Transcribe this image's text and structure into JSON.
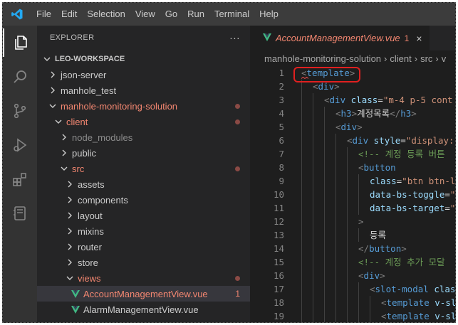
{
  "menu": [
    "File",
    "Edit",
    "Selection",
    "View",
    "Go",
    "Run",
    "Terminal",
    "Help"
  ],
  "icons": {
    "logo": "vscode-logo-icon",
    "explorer": "files-icon",
    "search": "search-icon",
    "scm": "source-control-icon",
    "debug": "run-debug-icon",
    "extensions": "extensions-icon",
    "notebook": "remote-explorer-icon"
  },
  "sidebar": {
    "title": "EXPLORER",
    "more": "···",
    "workspace": "LEO-WORKSPACE",
    "tree": [
      {
        "label": "json-server",
        "depth": 0,
        "open": false,
        "color": "normal"
      },
      {
        "label": "manhole_test",
        "depth": 0,
        "open": false,
        "color": "normal"
      },
      {
        "label": "manhole-monitoring-solution",
        "depth": 0,
        "open": true,
        "color": "red",
        "dot": true
      },
      {
        "label": "client",
        "depth": 1,
        "open": true,
        "color": "red",
        "dot": true
      },
      {
        "label": "node_modules",
        "depth": 2,
        "open": false,
        "color": "dim"
      },
      {
        "label": "public",
        "depth": 2,
        "open": false,
        "color": "normal"
      },
      {
        "label": "src",
        "depth": 2,
        "open": true,
        "color": "red",
        "dot": true
      },
      {
        "label": "assets",
        "depth": 3,
        "open": false,
        "color": "normal"
      },
      {
        "label": "components",
        "depth": 3,
        "open": false,
        "color": "normal"
      },
      {
        "label": "layout",
        "depth": 3,
        "open": false,
        "color": "normal"
      },
      {
        "label": "mixins",
        "depth": 3,
        "open": false,
        "color": "normal"
      },
      {
        "label": "router",
        "depth": 3,
        "open": false,
        "color": "normal"
      },
      {
        "label": "store",
        "depth": 3,
        "open": false,
        "color": "normal"
      },
      {
        "label": "views",
        "depth": 3,
        "open": true,
        "color": "red",
        "dot": true
      },
      {
        "label": "AccountManagementView.vue",
        "depth": 4,
        "file": true,
        "color": "red",
        "selected": true,
        "badge": "1"
      },
      {
        "label": "AlarmManagementView.vue",
        "depth": 4,
        "file": true,
        "color": "normal"
      }
    ]
  },
  "editor": {
    "tab": {
      "label": "AccountManagementView.vue",
      "errors": "1",
      "close": "×"
    },
    "breadcrumb": [
      "manhole-monitoring-solution",
      "client",
      "src",
      "v"
    ],
    "lines": [
      {
        "n": "1",
        "indent": 0,
        "parts": [
          [
            "br",
            "<"
          ],
          [
            "tag",
            "template"
          ],
          [
            "br",
            ">"
          ]
        ]
      },
      {
        "n": "2",
        "indent": 1,
        "parts": [
          [
            "br",
            "<"
          ],
          [
            "tag",
            "div"
          ],
          [
            "br",
            ">"
          ]
        ]
      },
      {
        "n": "3",
        "indent": 2,
        "parts": [
          [
            "br",
            "<"
          ],
          [
            "tag",
            "div"
          ],
          [
            "txt",
            " "
          ],
          [
            "attr",
            "class"
          ],
          [
            "txt",
            "="
          ],
          [
            "str",
            "\"m-4 p-5 cont"
          ]
        ]
      },
      {
        "n": "4",
        "indent": 3,
        "parts": [
          [
            "br",
            "<"
          ],
          [
            "tag",
            "h3"
          ],
          [
            "br",
            ">"
          ],
          [
            "txt",
            "계정목록"
          ],
          [
            "br",
            "</"
          ],
          [
            "tag",
            "h3"
          ],
          [
            "br",
            ">"
          ]
        ]
      },
      {
        "n": "5",
        "indent": 3,
        "parts": [
          [
            "br",
            "<"
          ],
          [
            "tag",
            "div"
          ],
          [
            "br",
            ">"
          ]
        ]
      },
      {
        "n": "6",
        "indent": 4,
        "parts": [
          [
            "br",
            "<"
          ],
          [
            "tag",
            "div"
          ],
          [
            "txt",
            " "
          ],
          [
            "attr",
            "style"
          ],
          [
            "txt",
            "="
          ],
          [
            "str",
            "\"display:"
          ]
        ]
      },
      {
        "n": "7",
        "indent": 5,
        "parts": [
          [
            "com",
            "<!-- 계정 등록 버튼"
          ]
        ]
      },
      {
        "n": "8",
        "indent": 5,
        "parts": [
          [
            "br",
            "<"
          ],
          [
            "tag",
            "button"
          ]
        ]
      },
      {
        "n": "9",
        "indent": 6,
        "parts": [
          [
            "attr",
            "class"
          ],
          [
            "txt",
            "="
          ],
          [
            "str",
            "\"btn btn-l"
          ]
        ]
      },
      {
        "n": "10",
        "indent": 6,
        "parts": [
          [
            "attr",
            "data-bs-toggle"
          ],
          [
            "txt",
            "="
          ],
          [
            "str",
            "\""
          ]
        ]
      },
      {
        "n": "11",
        "indent": 6,
        "parts": [
          [
            "attr",
            "data-bs-target"
          ],
          [
            "txt",
            "="
          ],
          [
            "str",
            "\""
          ]
        ]
      },
      {
        "n": "12",
        "indent": 5,
        "parts": [
          [
            "br",
            ">"
          ]
        ]
      },
      {
        "n": "13",
        "indent": 6,
        "parts": [
          [
            "txt",
            "등록"
          ]
        ]
      },
      {
        "n": "14",
        "indent": 5,
        "parts": [
          [
            "br",
            "</"
          ],
          [
            "tag",
            "button"
          ],
          [
            "br",
            ">"
          ]
        ]
      },
      {
        "n": "15",
        "indent": 5,
        "parts": [
          [
            "com",
            "<!-- 계정 추가 모달"
          ]
        ]
      },
      {
        "n": "16",
        "indent": 5,
        "parts": [
          [
            "br",
            "<"
          ],
          [
            "tag",
            "div"
          ],
          [
            "br",
            ">"
          ]
        ]
      },
      {
        "n": "17",
        "indent": 6,
        "parts": [
          [
            "br",
            "<"
          ],
          [
            "tag",
            "slot-modal"
          ],
          [
            "txt",
            " "
          ],
          [
            "attr",
            "clas"
          ]
        ]
      },
      {
        "n": "18",
        "indent": 7,
        "parts": [
          [
            "br",
            "<"
          ],
          [
            "tag",
            "template"
          ],
          [
            "txt",
            " "
          ],
          [
            "attr",
            "v-sl"
          ]
        ]
      },
      {
        "n": "19",
        "indent": 7,
        "parts": [
          [
            "br",
            "<"
          ],
          [
            "tag",
            "template"
          ],
          [
            "txt",
            " "
          ],
          [
            "attr",
            "v-sl"
          ]
        ]
      }
    ]
  }
}
